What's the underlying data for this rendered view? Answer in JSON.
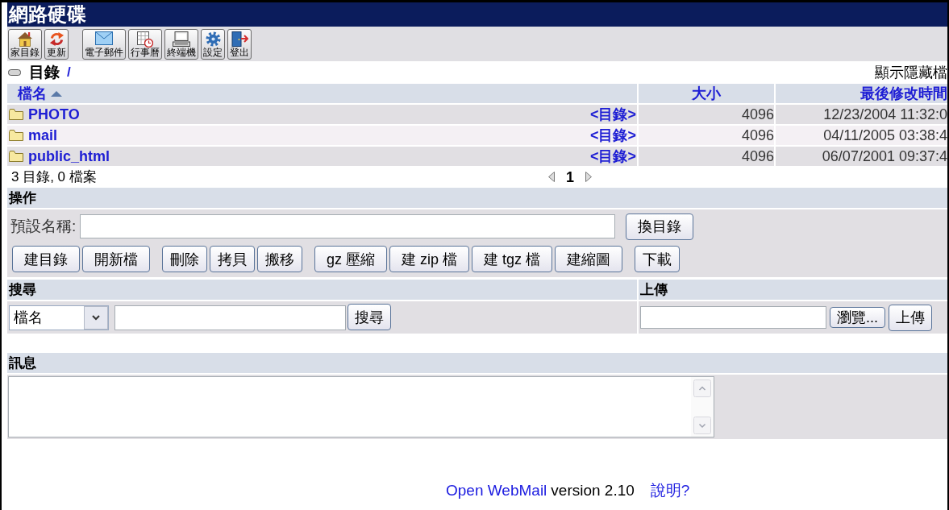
{
  "window": {
    "title": "網路硬碟"
  },
  "toolbar": {
    "groups": [
      [
        {
          "label": "家目錄"
        },
        {
          "label": "更新"
        }
      ],
      [
        {
          "label": "電子郵件"
        },
        {
          "label": "行事曆"
        },
        {
          "label": "終端機"
        },
        {
          "label": "設定"
        },
        {
          "label": "登出"
        }
      ]
    ]
  },
  "location": {
    "label": "目錄",
    "path": "/",
    "show_hidden_link": "顯示隱藏檔"
  },
  "file_table": {
    "columns": [
      {
        "label": "檔名",
        "sorted": true
      },
      {
        "label": "大小",
        "sorted": false
      },
      {
        "label": "最後修改時間",
        "sorted": false
      }
    ],
    "rows": [
      {
        "name": "PHOTO",
        "type": "<目錄>",
        "size": "4096",
        "modified": "12/23/2004 11:32:0"
      },
      {
        "name": "mail",
        "type": "<目錄>",
        "size": "4096",
        "modified": "04/11/2005 03:38:4"
      },
      {
        "name": "public_html",
        "type": "<目錄>",
        "size": "4096",
        "modified": "06/07/2001 09:37:4"
      }
    ],
    "summary": "3 目錄, 0 檔案",
    "pager": {
      "page": "1"
    }
  },
  "operations": {
    "title": "操作",
    "name_label": "預設名稱:",
    "change_dir_button": "換目錄",
    "button_groups": [
      [
        "建目錄",
        "開新檔"
      ],
      [
        "刪除",
        "拷貝",
        "搬移"
      ],
      [
        "gz 壓縮",
        "建 zip 檔",
        "建 tgz 檔",
        "建縮圖"
      ],
      [
        "下載"
      ]
    ]
  },
  "search": {
    "title": "搜尋",
    "filter": "檔名",
    "button": "搜尋"
  },
  "upload": {
    "title": "上傳",
    "browse_button": "瀏覽...",
    "button": "上傳"
  },
  "messages": {
    "title": "訊息"
  },
  "footer": {
    "link": "Open WebMail",
    "version": "version 2.10",
    "help_link": "說明?"
  }
}
